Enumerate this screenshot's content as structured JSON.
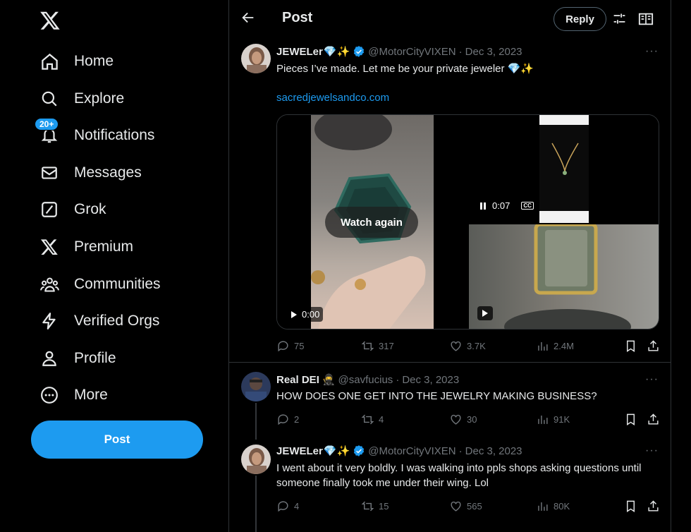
{
  "sidebar": {
    "logo": "x-logo-icon",
    "nav": [
      {
        "label": "Home",
        "icon": "home-icon"
      },
      {
        "label": "Explore",
        "icon": "search-icon"
      },
      {
        "label": "Notifications",
        "icon": "bell-icon",
        "badge": "20+"
      },
      {
        "label": "Messages",
        "icon": "envelope-icon"
      },
      {
        "label": "Grok",
        "icon": "grok-icon"
      },
      {
        "label": "Premium",
        "icon": "x-premium-icon"
      },
      {
        "label": "Communities",
        "icon": "communities-icon"
      },
      {
        "label": "Verified Orgs",
        "icon": "lightning-icon"
      },
      {
        "label": "Profile",
        "icon": "person-icon"
      },
      {
        "label": "More",
        "icon": "more-circle-icon"
      }
    ],
    "post_button": "Post"
  },
  "header": {
    "title": "Post",
    "reply_button": "Reply"
  },
  "tweets": [
    {
      "name": "JEWELer",
      "name_emoji": "💎✨",
      "verified": true,
      "handle": "@MotorCityVIXEN",
      "date": "Dec 3, 2023",
      "text": "Pieces I’ve made. Let me be your private jeweler 💎✨",
      "link": "sacredjewelsandco.com",
      "media": {
        "watch_again": "Watch again",
        "video1_time": "0:00",
        "video2_time": "0:07"
      },
      "stats": {
        "replies": "75",
        "reposts": "317",
        "likes": "3.7K",
        "views": "2.4M"
      }
    },
    {
      "name": "Real DEI",
      "name_emoji": "🥷",
      "verified": false,
      "handle": "@savfucius",
      "date": "Dec 3, 2023",
      "text": "HOW DOES ONE GET INTO THE JEWELRY MAKING BUSINESS?",
      "stats": {
        "replies": "2",
        "reposts": "4",
        "likes": "30",
        "views": "91K"
      }
    },
    {
      "name": "JEWELer",
      "name_emoji": "💎✨",
      "verified": true,
      "handle": "@MotorCityVIXEN",
      "date": "Dec 3, 2023",
      "text": "I went about it very boldly. I was walking into ppls shops asking questions until someone finally took me under their wing. Lol",
      "stats": {
        "replies": "4",
        "reposts": "15",
        "likes": "565",
        "views": "80K"
      }
    }
  ],
  "colors": {
    "accent": "#1d9bf0",
    "background": "#000000",
    "muted": "#71767b",
    "border": "#2f3336"
  }
}
